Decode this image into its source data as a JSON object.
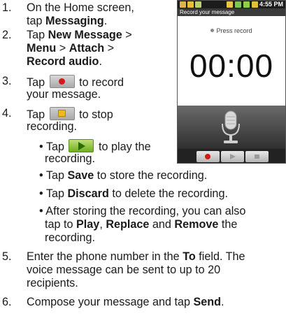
{
  "steps": [
    {
      "num": "1.",
      "line1": "On the Home screen,",
      "line2_pre": "tap ",
      "line2_bold": "Messaging",
      "line2_post": "."
    },
    {
      "num": "2.",
      "l1_pre": "Tap ",
      "l1_b1": "New Message",
      "l1_sep": " >",
      "l2_b1": "Menu",
      "l2_sep": " > ",
      "l2_b2": "Attach",
      "l2_end": " >",
      "l3_b": "Record audio",
      "l3_end": "."
    },
    {
      "num": "3.",
      "l1_pre": "Tap",
      "l1_post": "to record",
      "line2": "your message."
    },
    {
      "num": "4.",
      "l1_pre": "Tap",
      "l1_post": "to stop",
      "line2": "recording."
    }
  ],
  "bullets": {
    "play_pre": "• Tap",
    "play_post": "to play the",
    "play_line2": "recording.",
    "save_pre": "• Tap ",
    "save_bold": "Save",
    "save_post": " to store the recording.",
    "discard_pre": "• Tap ",
    "discard_bold": "Discard",
    "discard_post": " to delete the recording.",
    "after_l1": "• After storing the recording, you can also",
    "after_l2_pre": "tap to ",
    "after_play": "Play",
    "after_sep1": ", ",
    "after_replace": "Replace",
    "after_sep2": " and ",
    "after_remove": "Remove",
    "after_l2_post": " the",
    "after_l3": "recording."
  },
  "step5": {
    "num": "5.",
    "l1_pre": "Enter the phone number in the ",
    "l1_bold": "To",
    "l1_post": " field. The",
    "l2": "voice message can be sent to up to 20",
    "l3": "recipients."
  },
  "step6": {
    "num": "6.",
    "pre": "Compose your message and tap ",
    "bold": "Send",
    "post": "."
  },
  "phone": {
    "status_time": "4:55 PM",
    "title": "Record your message",
    "press_label": "Press record",
    "timer": "00:00"
  },
  "icons": {
    "record": "record-button-icon",
    "stop": "stop-button-icon",
    "play": "play-button-icon",
    "mic": "microphone-icon"
  }
}
